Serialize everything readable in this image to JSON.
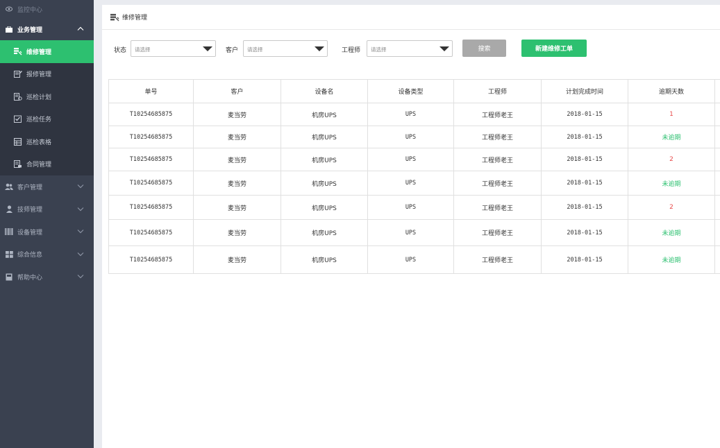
{
  "sidebar": {
    "top_item": {
      "label": "监控中心",
      "icon": "eye-icon"
    },
    "open_group": {
      "label": "业务管理",
      "icon": "briefcase-icon"
    },
    "sub_items": [
      {
        "label": "维修管理",
        "icon": "repair-icon",
        "active": true
      },
      {
        "label": "报修管理",
        "icon": "edit-icon",
        "active": false
      },
      {
        "label": "巡检计划",
        "icon": "plan-icon",
        "active": false
      },
      {
        "label": "巡检任务",
        "icon": "task-icon",
        "active": false
      },
      {
        "label": "巡检表格",
        "icon": "table-icon",
        "active": false
      },
      {
        "label": "合同管理",
        "icon": "contract-icon",
        "active": false
      }
    ],
    "groups": [
      {
        "label": "客户管理",
        "icon": "users-icon"
      },
      {
        "label": "技师管理",
        "icon": "user-icon"
      },
      {
        "label": "设备管理",
        "icon": "barcode-icon"
      },
      {
        "label": "综合信息",
        "icon": "grid-icon"
      },
      {
        "label": "帮助中心",
        "icon": "book-icon"
      }
    ]
  },
  "page": {
    "title": "维修管理"
  },
  "filters": {
    "status_label": "状态",
    "status_placeholder": "请选择",
    "customer_label": "客户",
    "customer_placeholder": "请选择",
    "engineer_label": "工程师",
    "engineer_placeholder": "请选择",
    "search_button": "搜索",
    "new_button": "新建维修工单"
  },
  "table": {
    "columns": [
      "单号",
      "客户",
      "设备名",
      "设备类型",
      "工程师",
      "计划完成时间",
      "逾期天数"
    ],
    "rows": [
      {
        "id": "T10254685875",
        "customer": "麦当劳",
        "device": "机房UPS",
        "type": "UPS",
        "engineer": "工程师老王",
        "date": "2018-01-15",
        "overdue": "1",
        "status": "red"
      },
      {
        "id": "T10254685875",
        "customer": "麦当劳",
        "device": "机房UPS",
        "type": "UPS",
        "engineer": "工程师老王",
        "date": "2018-01-15",
        "overdue": "未逾期",
        "status": "green"
      },
      {
        "id": "T10254685875",
        "customer": "麦当劳",
        "device": "机房UPS",
        "type": "UPS",
        "engineer": "工程师老王",
        "date": "2018-01-15",
        "overdue": "2",
        "status": "red"
      },
      {
        "id": "T10254685875",
        "customer": "麦当劳",
        "device": "机房UPS",
        "type": "UPS",
        "engineer": "工程师老王",
        "date": "2018-01-15",
        "overdue": "未逾期",
        "status": "green"
      },
      {
        "id": "T10254685875",
        "customer": "麦当劳",
        "device": "机房UPS",
        "type": "UPS",
        "engineer": "工程师老王",
        "date": "2018-01-15",
        "overdue": "2",
        "status": "red"
      },
      {
        "id": "T10254685875",
        "customer": "麦当劳",
        "device": "机房UPS",
        "type": "UPS",
        "engineer": "工程师老王",
        "date": "2018-01-15",
        "overdue": "未逾期",
        "status": "green"
      },
      {
        "id": "T10254685875",
        "customer": "麦当劳",
        "device": "机房UPS",
        "type": "UPS",
        "engineer": "工程师老王",
        "date": "2018-01-15",
        "overdue": "未逾期",
        "status": "green"
      }
    ]
  },
  "colors": {
    "accent": "#2dc070",
    "overdue": "#e84a4a",
    "sidebar": "#3a4150",
    "disabled_button": "#a9a9a9"
  }
}
